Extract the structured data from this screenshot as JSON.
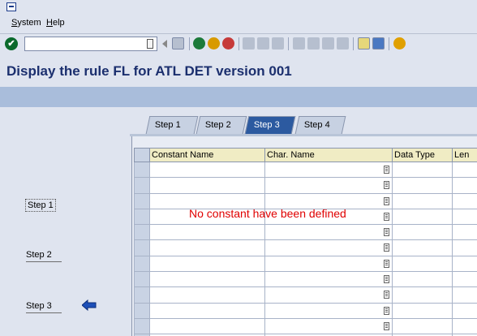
{
  "menu": {
    "items": [
      {
        "pre": "",
        "u": "S",
        "post": "ystem"
      },
      {
        "pre": "",
        "u": "H",
        "post": "elp"
      }
    ]
  },
  "title": "Display the rule FL for ATL DET version 001",
  "left_steps": [
    {
      "label": "Step 1"
    },
    {
      "label": "Step 2"
    },
    {
      "label": "Step 3"
    }
  ],
  "tabs": [
    {
      "label": "Step 1",
      "active": false
    },
    {
      "label": "Step 2",
      "active": false
    },
    {
      "label": "Step 3",
      "active": true
    },
    {
      "label": "Step 4",
      "active": false
    }
  ],
  "table": {
    "headers": [
      "Constant Name",
      "Char. Name",
      "Data Type",
      "Len"
    ],
    "row_count": 12
  },
  "message": "No constant have been defined",
  "colors": {
    "title": "#1b2f6e",
    "message": "#e00000",
    "active_tab": "#2c5aa0",
    "ok_button": "#0b6a2c"
  }
}
